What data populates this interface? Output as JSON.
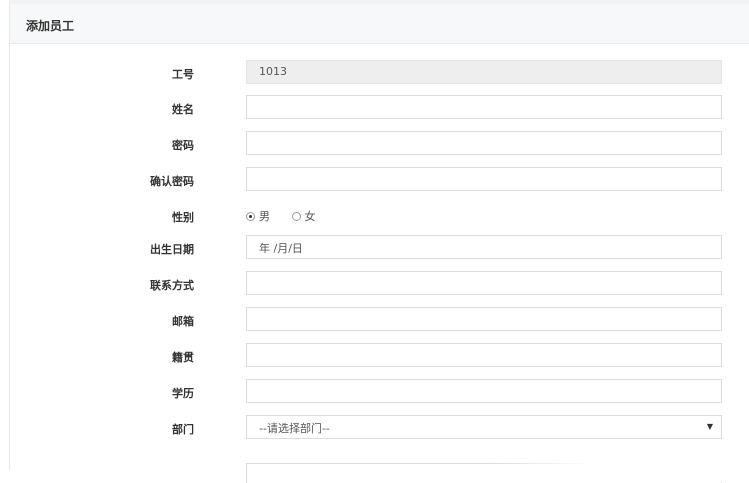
{
  "panel": {
    "title": "添加员工"
  },
  "form": {
    "employee_id": {
      "label": "工号",
      "value": "1013"
    },
    "name": {
      "label": "姓名",
      "value": ""
    },
    "password": {
      "label": "密码",
      "value": ""
    },
    "confirm_password": {
      "label": "确认密码",
      "value": ""
    },
    "gender": {
      "label": "性别",
      "options": [
        "男",
        "女"
      ],
      "selected": "男"
    },
    "birthday": {
      "label": "出生日期",
      "placeholder": "年 /月/日"
    },
    "contact": {
      "label": "联系方式",
      "value": ""
    },
    "email": {
      "label": "邮箱",
      "value": ""
    },
    "native_place": {
      "label": "籍贯",
      "value": ""
    },
    "education": {
      "label": "学历",
      "value": ""
    },
    "department": {
      "label": "部门",
      "selected": "--请选择部门--"
    }
  }
}
